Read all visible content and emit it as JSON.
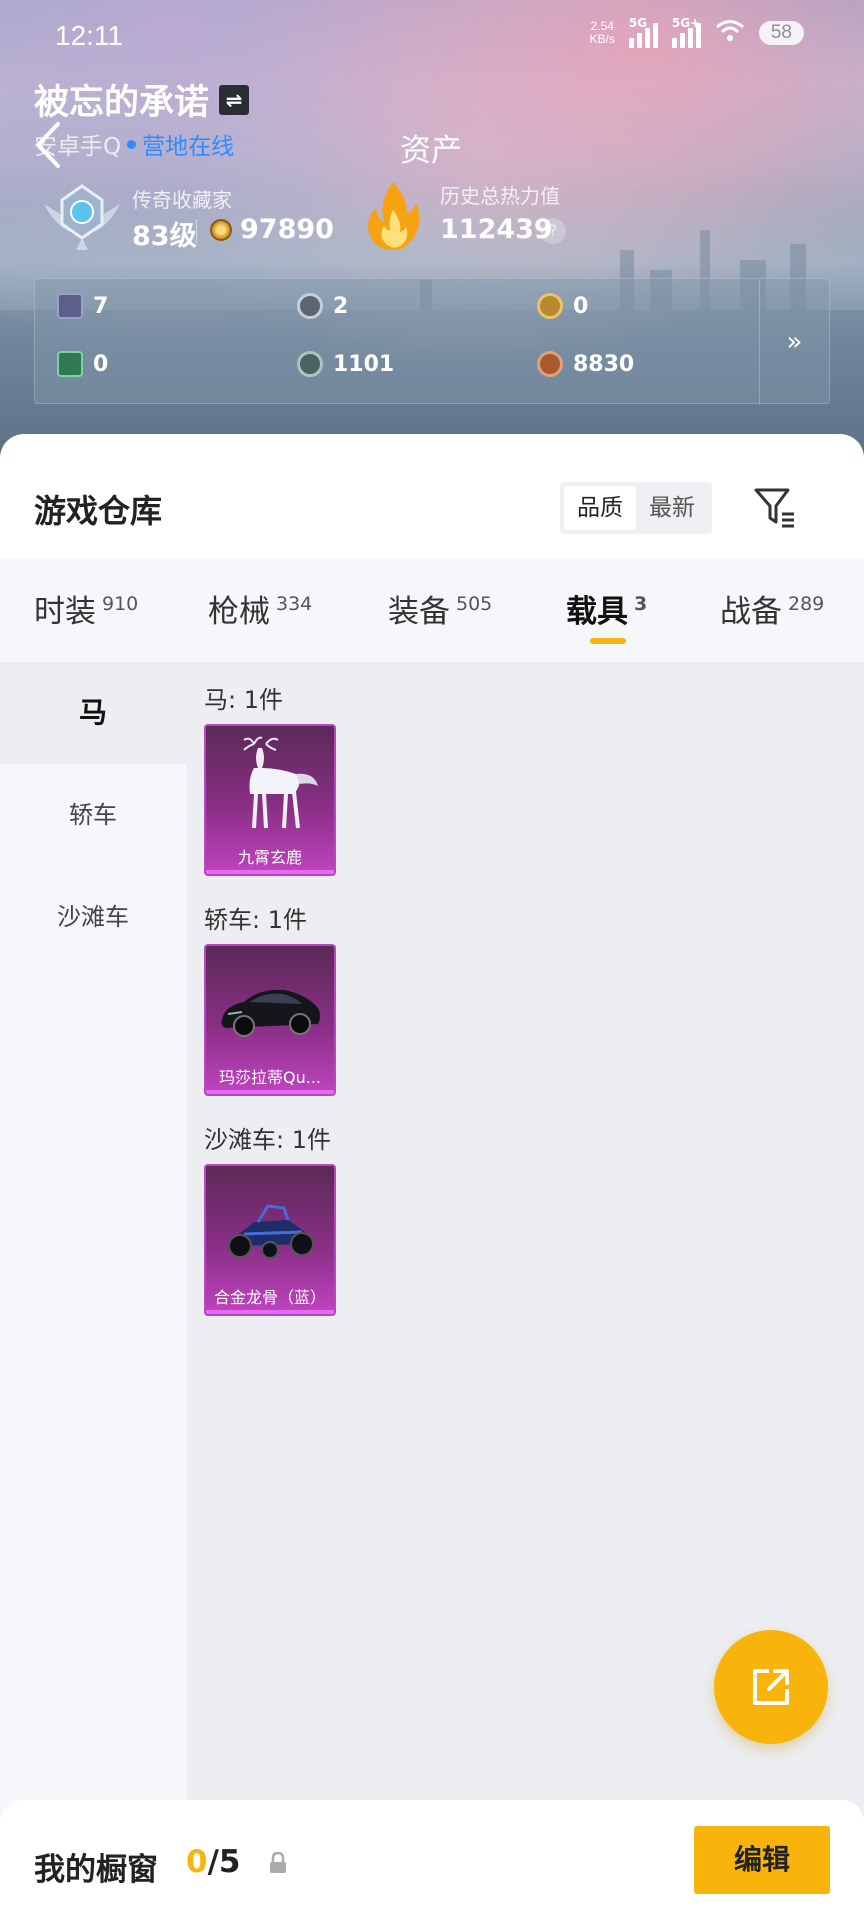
{
  "status_bar": {
    "time": "12:11",
    "net_speed_value": "2.54",
    "net_speed_unit": "KB/s",
    "sim1_label": "5G",
    "sim2_label": "5G+",
    "battery": "58"
  },
  "header": {
    "username": "被忘的承诺",
    "platform": "安卓手Q",
    "online_status": "营地在线",
    "page_title": "资产",
    "rank": {
      "title": "传奇收藏家",
      "level": "83级",
      "coins": "97890"
    },
    "heat": {
      "title": "历史总热力值",
      "value": "112439"
    },
    "assets": [
      {
        "icon": "card-icon",
        "value": "7",
        "color": "#5b5f8a"
      },
      {
        "icon": "coin-ring-icon",
        "value": "2",
        "color": "#5c6470"
      },
      {
        "icon": "gold-badge-icon",
        "value": "0",
        "color": "#b8892e"
      },
      {
        "icon": "green-card-icon",
        "value": "0",
        "color": "#2f7a52"
      },
      {
        "icon": "orb-icon",
        "value": "1101",
        "color": "#4b6460"
      },
      {
        "icon": "bronze-coin-icon",
        "value": "8830",
        "color": "#a85a2e"
      }
    ]
  },
  "warehouse": {
    "title": "游戏仓库",
    "sort_options": [
      "品质",
      "最新"
    ],
    "tabs": [
      {
        "label": "时装",
        "count": "910"
      },
      {
        "label": "枪械",
        "count": "334"
      },
      {
        "label": "装备",
        "count": "505"
      },
      {
        "label": "载具",
        "count": "3"
      },
      {
        "label": "战备",
        "count": "289"
      }
    ],
    "categories": [
      "马",
      "轿车",
      "沙滩车"
    ],
    "sections": [
      {
        "label": "马: 1件",
        "item_name": "九霄玄鹿"
      },
      {
        "label": "轿车: 1件",
        "item_name": "玛莎拉蒂Qu..."
      },
      {
        "label": "沙滩车: 1件",
        "item_name": "合金龙骨（蓝）"
      }
    ]
  },
  "showcase": {
    "title": "我的橱窗",
    "current": "0",
    "total": "/5",
    "edit_label": "编辑"
  },
  "colors": {
    "accent": "#f9b40c",
    "online": "#2e8bff",
    "rarity_purple": "#b548c0"
  }
}
